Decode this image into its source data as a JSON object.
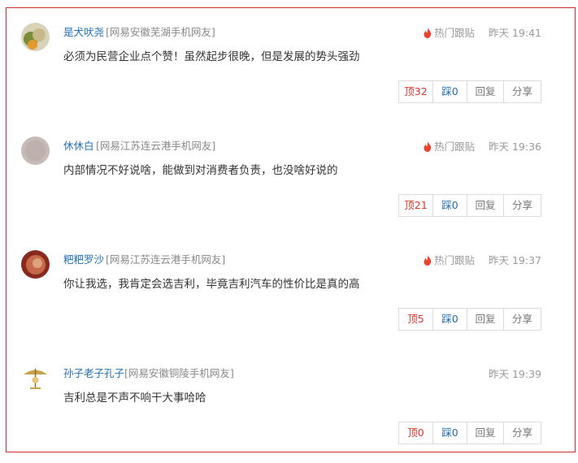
{
  "comments": [
    {
      "username": "是犬吠尧",
      "location": "[网易安徽芜湖手机网友]",
      "hot_label": "热门跟贴",
      "time": "昨天 19:41",
      "text": "必须为民营企业点个赞！虽然起步很晚，但是发展的势头强劲",
      "up": "顶32",
      "down": "踩0",
      "reply": "回复",
      "share": "分享"
    },
    {
      "username": "休休白",
      "location": "[网易江苏连云港手机网友]",
      "hot_label": "热门跟贴",
      "time": "昨天 19:36",
      "text": "内部情况不好说啥，能做到对消费者负责，也没啥好说的",
      "up": "顶21",
      "down": "踩0",
      "reply": "回复",
      "share": "分享"
    },
    {
      "username": "粑粑罗沙",
      "location": "[网易江苏连云港手机网友]",
      "hot_label": "热门跟贴",
      "time": "昨天 19:37",
      "text": "你让我选，我肯定会选吉利，毕竟吉利汽车的性价比是真的高",
      "up": "顶5",
      "down": "踩0",
      "reply": "回复",
      "share": "分享"
    },
    {
      "username": "孙子老子孔子",
      "location": "[网易安徽铜陵手机网友]",
      "time": "昨天 19:39",
      "text": "吉利总是不声不响干大事哈哈",
      "up": "顶0",
      "down": "踩0",
      "reply": "回复",
      "share": "分享"
    }
  ],
  "colors": {
    "border": "#c9302c",
    "username": "#1f6fb5",
    "up": "#d9342b",
    "down": "#1f6fb5",
    "flame": "#e8432e"
  }
}
